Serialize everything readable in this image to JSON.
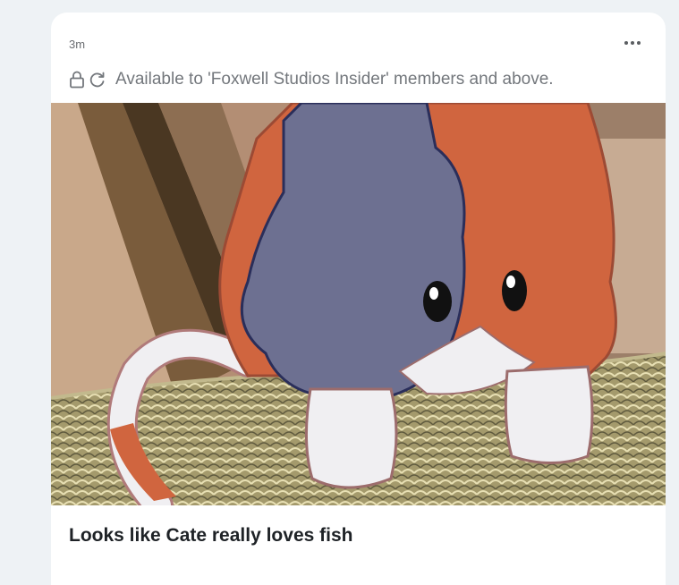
{
  "post": {
    "timestamp": "3m",
    "access_notice": "Available to 'Foxwell Studios Insider' members and above.",
    "title": "Looks like Cate really loves fish",
    "icons": {
      "menu": "more-horizontal-icon",
      "lock": "lock-icon",
      "refresh": "refresh-icon"
    },
    "image": {
      "description_name": "post-image"
    }
  },
  "colors": {
    "page_bg": "#eef2f5",
    "card_bg": "#ffffff",
    "muted_text": "#73777c",
    "title_text": "#1e2226"
  }
}
